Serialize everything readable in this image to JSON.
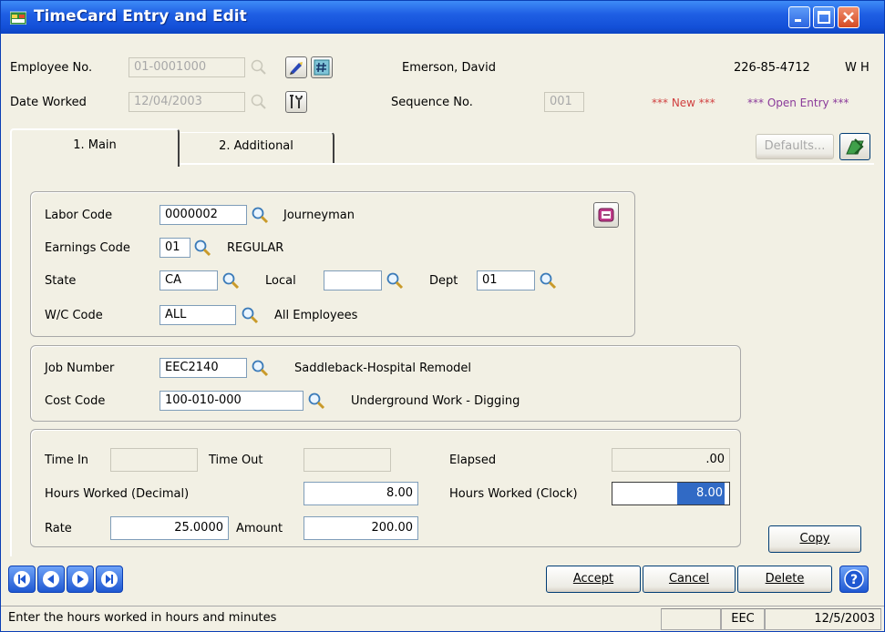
{
  "window": {
    "title": "TimeCard Entry and Edit"
  },
  "header": {
    "employee_no_label": "Employee No.",
    "employee_no_value": "01-0001000",
    "employee_name": "Emerson, David",
    "ssn": "226-85-4712",
    "status_flags": "W H",
    "date_worked_label": "Date Worked",
    "date_worked_value": "12/04/2003",
    "sequence_no_label": "Sequence No.",
    "sequence_no_value": "001",
    "new_flag": "*** New ***",
    "open_entry_flag": "*** Open Entry ***"
  },
  "tabs": [
    {
      "label": "1. Main"
    },
    {
      "label": "2. Additional"
    }
  ],
  "defaults_button": "Defaults...",
  "labor": {
    "labor_code_label": "Labor Code",
    "labor_code_value": "0000002",
    "labor_code_desc": "Journeyman",
    "earnings_code_label": "Earnings Code",
    "earnings_code_value": "01",
    "earnings_code_desc": "REGULAR",
    "state_label": "State",
    "state_value": "CA",
    "local_label": "Local",
    "local_value": "",
    "dept_label": "Dept",
    "dept_value": "01",
    "wc_code_label": "W/C Code",
    "wc_code_value": "ALL",
    "wc_code_desc": "All Employees"
  },
  "job": {
    "job_number_label": "Job Number",
    "job_number_value": "EEC2140",
    "job_number_desc": "Saddleback-Hospital Remodel",
    "cost_code_label": "Cost Code",
    "cost_code_value": "100-010-000",
    "cost_code_desc": "Underground Work - Digging"
  },
  "time": {
    "time_in_label": "Time In",
    "time_in_value": "",
    "time_out_label": "Time Out",
    "time_out_value": "",
    "elapsed_label": "Elapsed",
    "elapsed_value": ".00",
    "hours_decimal_label": "Hours Worked (Decimal)",
    "hours_decimal_value": "8.00",
    "hours_clock_label": "Hours Worked (Clock)",
    "hours_clock_value": "8.00",
    "rate_label": "Rate",
    "rate_value": "25.0000",
    "amount_label": "Amount",
    "amount_value": "200.00"
  },
  "buttons": {
    "copy": "Copy",
    "accept": "Accept",
    "cancel": "Cancel",
    "delete": "Delete",
    "help": "?"
  },
  "statusbar": {
    "message": "Enter the hours  worked in hours and minutes",
    "company": "EEC",
    "date": "12/5/2003"
  },
  "colors": {
    "titlebar": "#1f5fe4",
    "selection": "#316ac5",
    "new_flag": "#d04040",
    "open_flag": "#8a3a9a"
  }
}
